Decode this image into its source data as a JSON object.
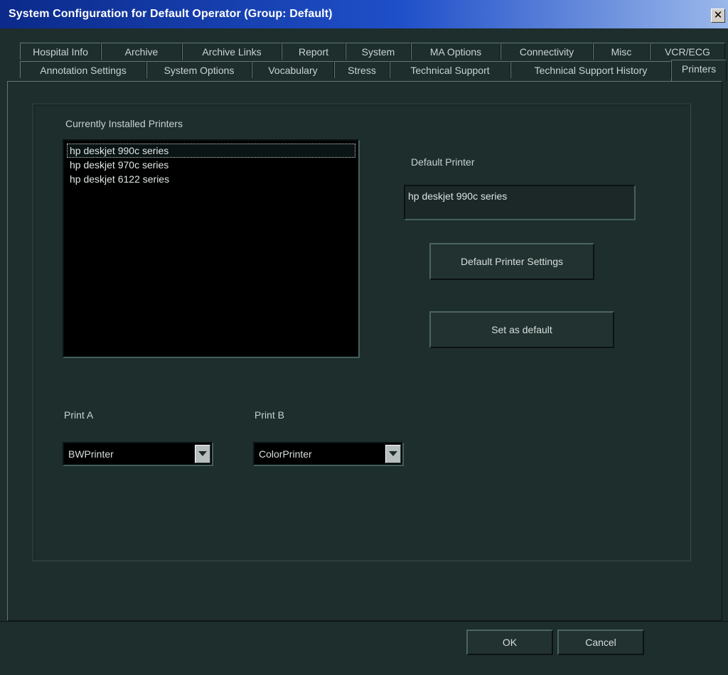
{
  "window": {
    "title": "System Configuration for Default Operator (Group: Default)",
    "close_icon": "close-icon"
  },
  "tabs": {
    "row1": [
      {
        "label": "Hospital Info"
      },
      {
        "label": "Archive"
      },
      {
        "label": "Archive Links"
      },
      {
        "label": "Report"
      },
      {
        "label": "System"
      },
      {
        "label": "MA Options"
      },
      {
        "label": "Connectivity"
      },
      {
        "label": "Misc"
      },
      {
        "label": "VCR/ECG"
      }
    ],
    "row2": [
      {
        "label": "Annotation Settings"
      },
      {
        "label": "System Options"
      },
      {
        "label": "Vocabulary"
      },
      {
        "label": "Stress"
      },
      {
        "label": "Technical Support"
      },
      {
        "label": "Technical Support History"
      },
      {
        "label": "Printers",
        "active": true
      }
    ]
  },
  "printers": {
    "installed_label": "Currently Installed Printers",
    "installed": [
      {
        "name": "hp deskjet 990c series",
        "selected": true
      },
      {
        "name": "hp deskjet 970c series"
      },
      {
        "name": "hp deskjet 6122 series"
      }
    ],
    "default_label": "Default Printer",
    "default_value": "hp deskjet 990c series",
    "settings_button": "Default Printer Settings",
    "set_default_button": "Set as default",
    "print_a": {
      "label": "Print A",
      "value": "BWPrinter"
    },
    "print_b": {
      "label": "Print B",
      "value": "ColorPrinter"
    }
  },
  "dialog": {
    "ok": "OK",
    "cancel": "Cancel"
  },
  "colors": {
    "background": "#1e2e2d",
    "title_bar": "#1f4fc9",
    "list_background": "#000000"
  }
}
